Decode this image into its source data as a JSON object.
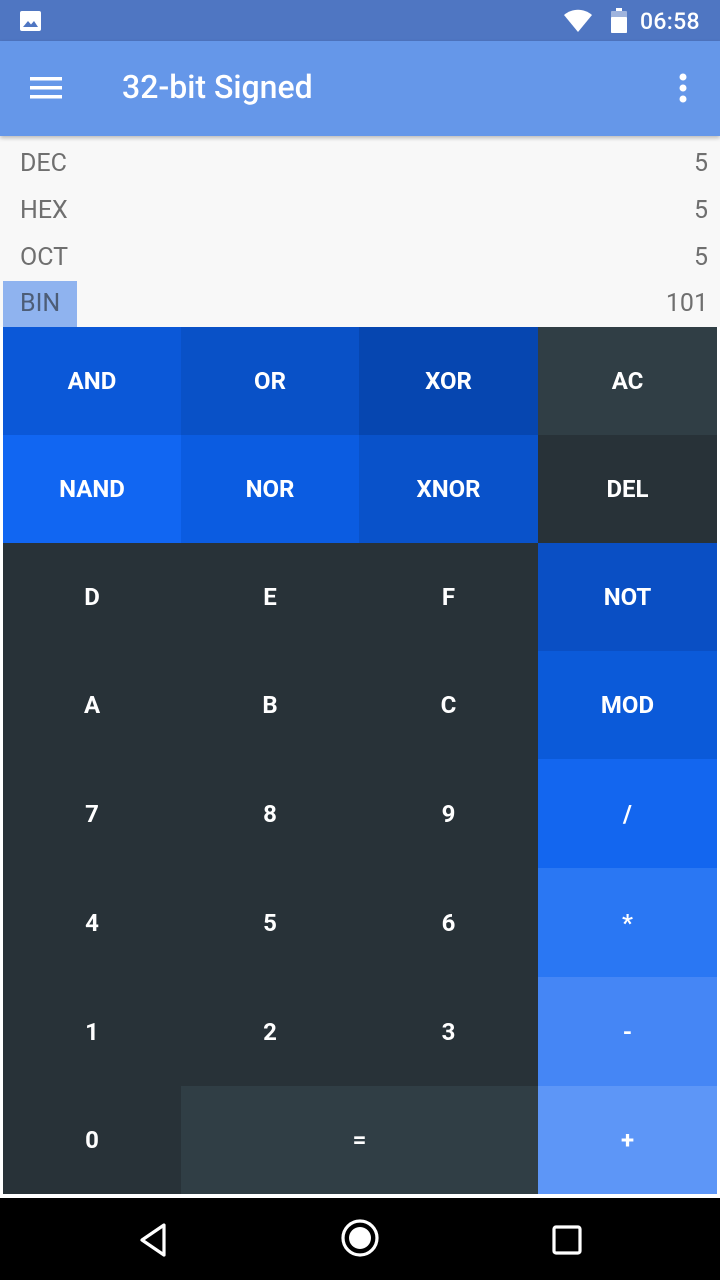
{
  "status_bar": {
    "time": "06:58",
    "icons": [
      "image-icon",
      "wifi-icon",
      "battery-icon"
    ]
  },
  "app_bar": {
    "title": "32-bit Signed",
    "menu_icon": "menu-icon",
    "overflow_icon": "more-vert-icon"
  },
  "readouts": [
    {
      "label": "DEC",
      "value": "5",
      "active": false
    },
    {
      "label": "HEX",
      "value": "5",
      "active": false
    },
    {
      "label": "OCT",
      "value": "5",
      "active": false
    },
    {
      "label": "BIN",
      "value": "101",
      "active": true
    }
  ],
  "keys": {
    "and": "AND",
    "or": "OR",
    "xor": "XOR",
    "ac": "AC",
    "nand": "NAND",
    "nor": "NOR",
    "xnor": "XNOR",
    "del": "DEL",
    "d": "D",
    "e": "E",
    "f": "F",
    "not": "NOT",
    "a": "A",
    "b": "B",
    "c": "C",
    "mod": "MOD",
    "seven": "7",
    "eight": "8",
    "nine": "9",
    "divide": "/",
    "four": "4",
    "five": "5",
    "six": "6",
    "multiply": "*",
    "one": "1",
    "two": "2",
    "three": "3",
    "minus": "-",
    "zero": "0",
    "equals": "=",
    "plus": "+"
  },
  "colors": {
    "status_bar": "#4f76c2",
    "app_bar": "#6597e9",
    "key_dark": "#283238",
    "key_dark_alt": "#303e45",
    "bin_highlight": "#8fb3ef"
  },
  "nav_bar": {
    "icons": [
      "back-icon",
      "home-icon",
      "recents-icon"
    ]
  }
}
